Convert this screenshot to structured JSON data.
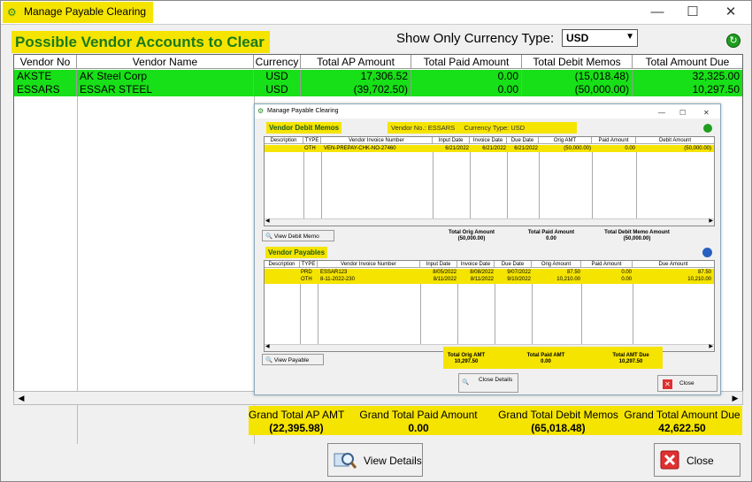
{
  "window": {
    "title": "Manage Payable Clearing",
    "minimize": "—",
    "maximize": "☐",
    "close": "✕"
  },
  "header": {
    "title": "Possible Vendor Accounts to Clear",
    "currency_label": "Show Only Currency Type:",
    "currency_value": "USD"
  },
  "grid": {
    "columns": [
      "Vendor No",
      "Vendor Name",
      "Currency",
      "Total AP Amount",
      "Total Paid Amount",
      "Total Debit Memos",
      "Total Amount Due"
    ],
    "rows": [
      {
        "vendor_no": "AKSTE",
        "vendor_name": "AK Steel Corp",
        "currency": "USD",
        "total_ap": "17,306.52",
        "total_paid": "0.00",
        "total_debit": "(15,018.48)",
        "total_due": "32,325.00"
      },
      {
        "vendor_no": "ESSARS",
        "vendor_name": "ESSAR STEEL",
        "currency": "USD",
        "total_ap": "(39,702.50)",
        "total_paid": "0.00",
        "total_debit": "(50,000.00)",
        "total_due": "10,297.50"
      }
    ]
  },
  "totals": {
    "ap_label": "Grand Total AP AMT",
    "ap_value": "(22,395.98)",
    "paid_label": "Grand Total Paid Amount",
    "paid_value": "0.00",
    "debit_label": "Grand Total Debit Memos",
    "debit_value": "(65,018.48)",
    "due_label": "Grand Total Amount Due",
    "due_value": "42,622.50"
  },
  "buttons": {
    "view_details": "View Details",
    "close": "Close"
  },
  "inner": {
    "title": "Manage Payable Clearing",
    "debit_section": "Vendor Debit Memos",
    "vendor_no_label": "Vendor No.: ESSARS",
    "currency_label": "Currency Type: USD",
    "debit_columns": [
      "Description",
      "TYPE",
      "Vendor Invoice Number",
      "Input Date",
      "Invoice Date",
      "Due Date",
      "Orig AMT",
      "Paid Amount",
      "Debit Amount"
    ],
    "debit_rows": [
      {
        "desc": "",
        "type": "OTH",
        "inv": "VEN-PREPAY-CHK-NO-27460",
        "input": "6/21/2022",
        "invdate": "6/21/2022",
        "due": "6/21/2022",
        "orig": "(50,000.00)",
        "paid": "0.00",
        "debit": "(50,000.00)"
      }
    ],
    "view_debit_memo": "View Debit Memo",
    "debit_tot_orig_label": "Total Orig Amount",
    "debit_tot_orig": "(50,000.00)",
    "debit_tot_paid_label": "Total Paid Amount",
    "debit_tot_paid": "0.00",
    "debit_tot_memo_label": "Total Debit Memo Amount",
    "debit_tot_memo": "(50,000.00)",
    "payables_section": "Vendor Payables",
    "pay_columns": [
      "Description",
      "TYPE",
      "Vendor Invoice Number",
      "Input Date",
      "Invoice Date",
      "Due Date",
      "Orig Amount",
      "Paid Amount",
      "Due Amount"
    ],
    "pay_rows": [
      {
        "desc": "",
        "type": "PRD",
        "inv": "ESSAR123",
        "input": "8/05/2022",
        "invdate": "8/08/2022",
        "due": "9/07/2022",
        "orig": "87.50",
        "paid": "0.00",
        "amt": "87.50"
      },
      {
        "desc": "",
        "type": "OTH",
        "inv": "8-11-2022-230",
        "input": "8/11/2022",
        "invdate": "8/11/2022",
        "due": "9/10/2022",
        "orig": "10,210.00",
        "paid": "0.00",
        "amt": "10,210.00"
      }
    ],
    "view_payable": "View Payable",
    "pay_tot_orig_label": "Total Orig AMT",
    "pay_tot_orig": "10,297.50",
    "pay_tot_paid_label": "Total Paid AMT",
    "pay_tot_paid": "0.00",
    "pay_tot_due_label": "Total AMT Due",
    "pay_tot_due": "10,297.50",
    "close_details": "Close Details",
    "close": "Close"
  }
}
